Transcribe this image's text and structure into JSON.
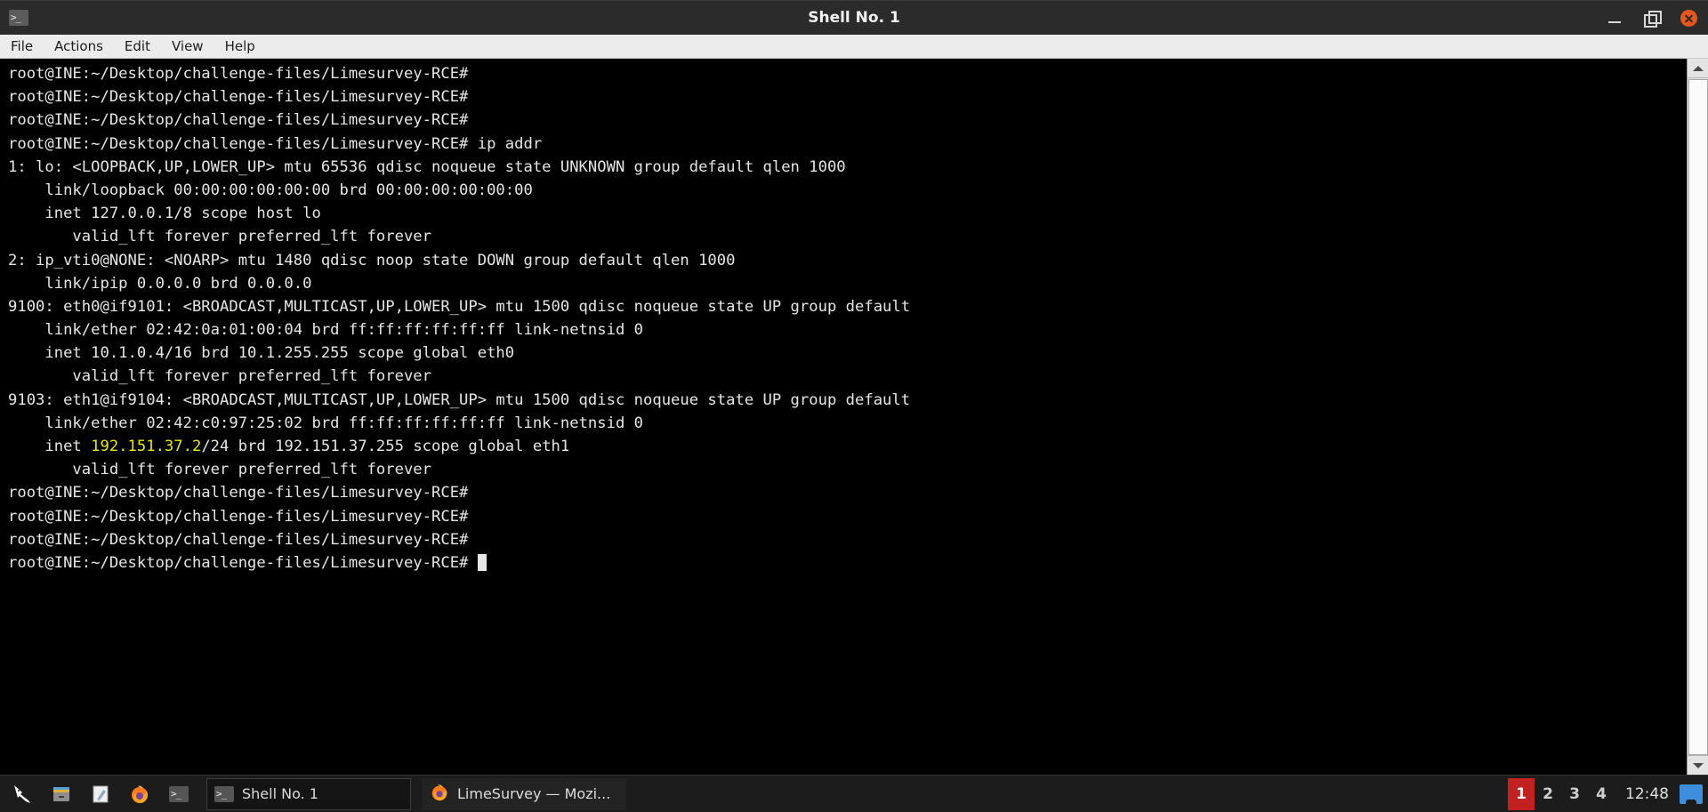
{
  "window": {
    "title": "Shell No. 1",
    "app_icon": "terminal-icon",
    "controls": {
      "minimize": "minimize-icon",
      "maximize": "maximize-icon",
      "close": "close-icon"
    }
  },
  "menubar": {
    "items": [
      {
        "label": "File"
      },
      {
        "label": "Actions"
      },
      {
        "label": "Edit"
      },
      {
        "label": "View"
      },
      {
        "label": "Help"
      }
    ]
  },
  "terminal": {
    "prompt": "root@INE:~/Desktop/challenge-files/Limesurvey-RCE#",
    "command": "ip addr",
    "highlight_color": "#e8e800",
    "foreground": "#e6e6e6",
    "background": "#000000",
    "lines": [
      "root@INE:~/Desktop/challenge-files/Limesurvey-RCE#",
      "root@INE:~/Desktop/challenge-files/Limesurvey-RCE#",
      "root@INE:~/Desktop/challenge-files/Limesurvey-RCE#",
      "root@INE:~/Desktop/challenge-files/Limesurvey-RCE# ip addr",
      "1: lo: <LOOPBACK,UP,LOWER_UP> mtu 65536 qdisc noqueue state UNKNOWN group default qlen 1000",
      "    link/loopback 00:00:00:00:00:00 brd 00:00:00:00:00:00",
      "    inet 127.0.0.1/8 scope host lo",
      "       valid_lft forever preferred_lft forever",
      "2: ip_vti0@NONE: <NOARP> mtu 1480 qdisc noop state DOWN group default qlen 1000",
      "    link/ipip 0.0.0.0 brd 0.0.0.0",
      "9100: eth0@if9101: <BROADCAST,MULTICAST,UP,LOWER_UP> mtu 1500 qdisc noqueue state UP group default",
      "    link/ether 02:42:0a:01:00:04 brd ff:ff:ff:ff:ff:ff link-netnsid 0",
      "    inet 10.1.0.4/16 brd 10.1.255.255 scope global eth0",
      "       valid_lft forever preferred_lft forever",
      "9103: eth1@if9104: <BROADCAST,MULTICAST,UP,LOWER_UP> mtu 1500 qdisc noqueue state UP group default",
      "    link/ether 02:42:c0:97:25:02 brd ff:ff:ff:ff:ff:ff link-netnsid 0",
      "",
      "       valid_lft forever preferred_lft forever",
      "root@INE:~/Desktop/challenge-files/Limesurvey-RCE#",
      "root@INE:~/Desktop/challenge-files/Limesurvey-RCE#",
      "root@INE:~/Desktop/challenge-files/Limesurvey-RCE#",
      ""
    ],
    "highlighted_line": {
      "index": 16,
      "prefix": "    inet ",
      "highlight": "192.151.37.2",
      "suffix": "/24 brd 192.151.37.255 scope global eth1"
    },
    "final_prompt_line": "root@INE:~/Desktop/challenge-files/Limesurvey-RCE# "
  },
  "scrollbar": {
    "up_arrow": "scroll-up-icon",
    "down_arrow": "scroll-down-icon"
  },
  "taskbar": {
    "launchers": [
      {
        "name": "kali-menu-icon",
        "label": "Kali"
      },
      {
        "name": "file-manager-icon",
        "label": "Files"
      },
      {
        "name": "text-editor-icon",
        "label": "Text Editor"
      },
      {
        "name": "firefox-icon",
        "label": "Firefox"
      },
      {
        "name": "terminal-icon",
        "label": "Terminal"
      }
    ],
    "tasks": [
      {
        "icon": "terminal-icon",
        "label": "Shell No. 1",
        "active": true
      },
      {
        "icon": "firefox-icon",
        "label": "LimeSurvey — Mozi...",
        "active": false
      }
    ],
    "workspaces": [
      {
        "label": "1",
        "active": true
      },
      {
        "label": "2",
        "active": false
      },
      {
        "label": "3",
        "active": false
      },
      {
        "label": "4",
        "active": false
      }
    ],
    "clock": "12:48",
    "tray_icon": "network-icon",
    "active_workspace_color": "#c32020"
  }
}
